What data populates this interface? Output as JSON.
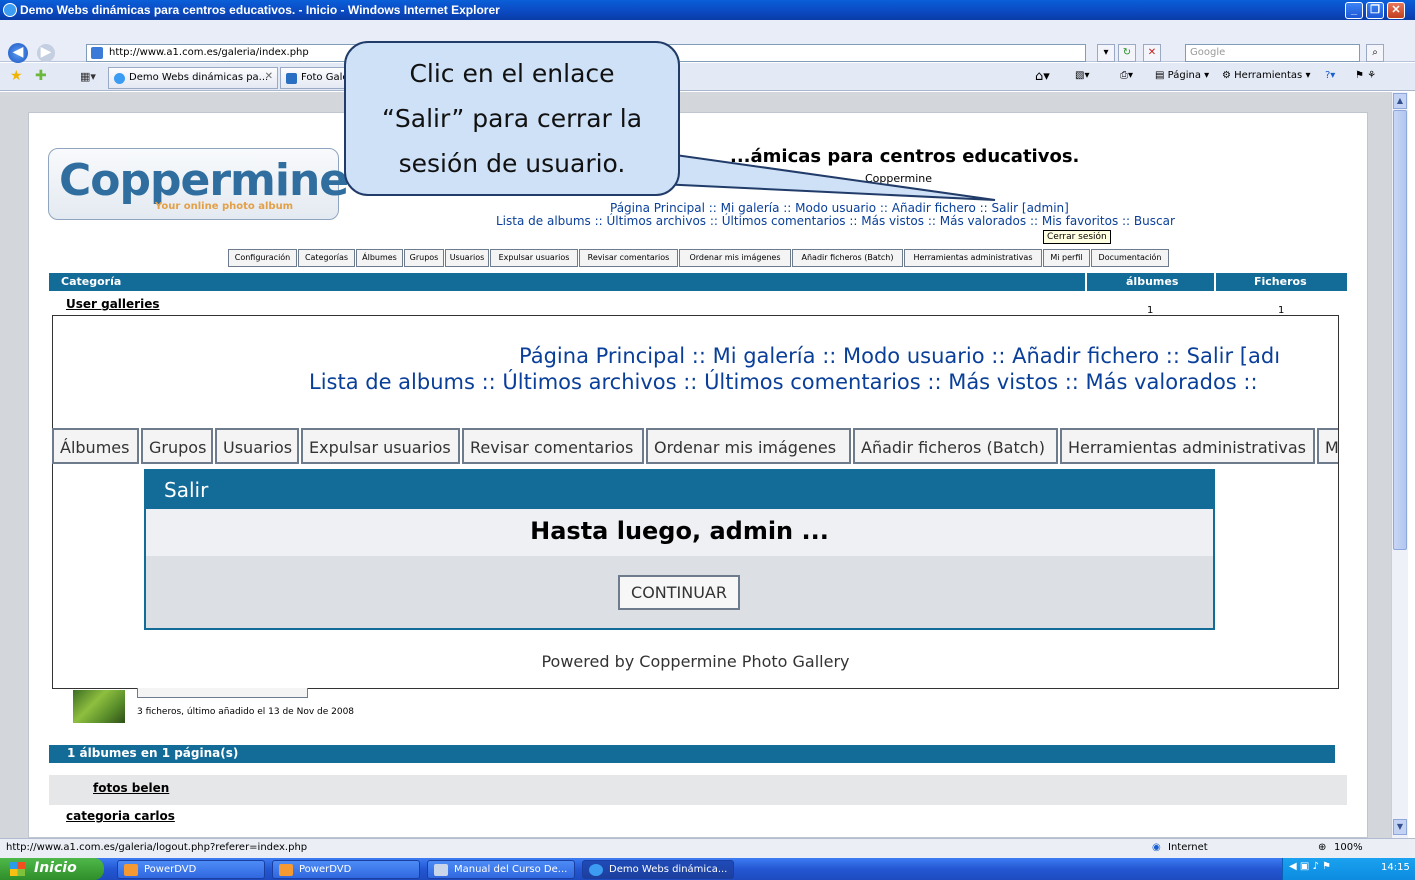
{
  "window": {
    "title": "Demo Webs dinámicas para centros educativos. - Inicio - Windows Internet Explorer"
  },
  "addressbar": {
    "url": "http://www.a1.com.es/galeria/index.php",
    "search_placeholder": "Google"
  },
  "tabs": [
    {
      "label": "Demo Webs dinámicas pa..."
    },
    {
      "label": "Foto Galer"
    }
  ],
  "toolbar": {
    "page_label": "Página",
    "tools_label": "Herramientas"
  },
  "callout": {
    "lines": [
      "Clic en el enlace",
      "“Salir” para cerrar la",
      "sesión de usuario."
    ]
  },
  "site": {
    "logo_text": "Coppermine",
    "logo_tagline": "Your online photo album",
    "title_visible": "...ámicas para centros educativos.",
    "subtitle_visible": "Coppermine",
    "nav_line1": "Página Principal :: Mi galería :: Modo usuario :: Añadir fichero :: Salir [admin]",
    "nav_line2": "Lista de albums :: Últimos archivos :: Últimos comentarios :: Más vistos :: Más valorados :: Mis favoritos :: Buscar",
    "tooltip": "Cerrar sesión"
  },
  "admin_menu": [
    "Configuración",
    "Categorías",
    "Álbumes",
    "Grupos",
    "Usuarios",
    "Expulsar usuarios",
    "Revisar comentarios",
    "Ordenar mis imágenes",
    "Añadir ficheros (Batch)",
    "Herramientas administrativas",
    "Mi perfil",
    "Documentación"
  ],
  "category_table": {
    "headers": {
      "category": "Categoría",
      "albums": "álbumes",
      "files": "Ficheros"
    },
    "rows": [
      {
        "name": "User galleries",
        "albums": "1",
        "files": "1"
      },
      {
        "name": "fotos belen"
      },
      {
        "name": "categoria carlos"
      }
    ],
    "album_info": "3 ficheros, último añadido el 13 de Nov de 2008",
    "album_footer": "1 álbumes en 1 página(s)"
  },
  "zoom": {
    "nav_line1": "Página Principal :: Mi galería :: Modo usuario :: Añadir fichero :: Salir [adı",
    "nav_line2": "Lista de albums :: Últimos archivos :: Últimos comentarios :: Más vistos :: Más valorados ::",
    "buttons": [
      "Álbumes",
      "Grupos",
      "Usuarios",
      "Expulsar usuarios",
      "Revisar comentarios",
      "Ordenar mis imágenes",
      "Añadir ficheros (Batch)",
      "Herramientas administrativas",
      "M"
    ],
    "dialog_title": "Salir",
    "dialog_message": "Hasta luego, admin ...",
    "continue_label": "CONTINUAR",
    "powered": "Powered by Coppermine Photo Gallery"
  },
  "statusbar": {
    "url": "http://www.a1.com.es/galeria/logout.php?referer=index.php",
    "zone": "Internet",
    "zoom": "100%"
  },
  "taskbar": {
    "start": "Inicio",
    "tasks": [
      "PowerDVD",
      "PowerDVD",
      "Manual del Curso De...",
      "Demo Webs dinámica..."
    ],
    "clock": "14:15"
  },
  "colors": {
    "header_blue": "#136b98",
    "link_blue": "#0a3f99",
    "callout_fill": "#cfe1f7"
  }
}
